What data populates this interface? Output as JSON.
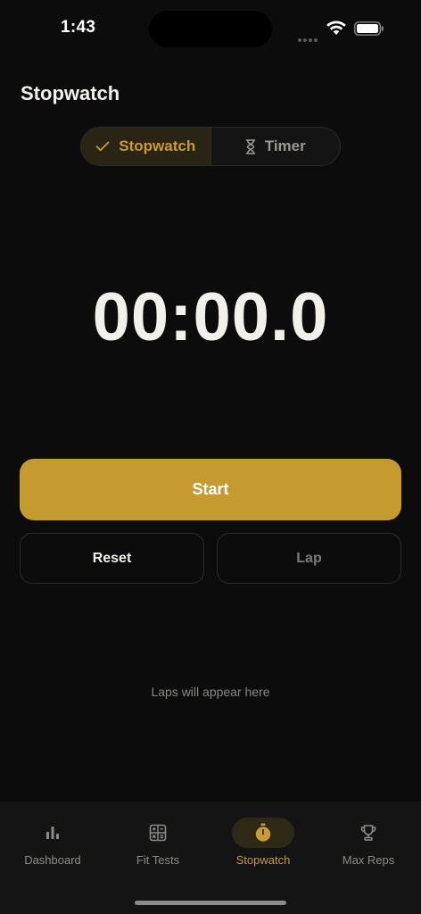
{
  "status_bar": {
    "time": "1:43"
  },
  "header": {
    "title": "Stopwatch"
  },
  "mode_switch": {
    "options": [
      {
        "label": "Stopwatch",
        "icon": "checkmark-icon",
        "selected": true
      },
      {
        "label": "Timer",
        "icon": "hourglass-icon",
        "selected": false
      }
    ]
  },
  "display": {
    "time": "00:00.0"
  },
  "controls": {
    "start_label": "Start",
    "reset_label": "Reset",
    "lap_label": "Lap"
  },
  "laps": {
    "empty_text": "Laps will appear here"
  },
  "tabbar": {
    "items": [
      {
        "label": "Dashboard",
        "icon": "bar-chart-icon",
        "active": false
      },
      {
        "label": "Fit Tests",
        "icon": "calculator-icon",
        "active": false
      },
      {
        "label": "Stopwatch",
        "icon": "stopwatch-icon",
        "active": true
      },
      {
        "label": "Max Reps",
        "icon": "trophy-icon",
        "active": false
      }
    ]
  },
  "colors": {
    "background": "#0c0c0c",
    "accent": "#c59a2f",
    "text_primary": "#f2f0ea",
    "text_muted": "#8e8c86"
  }
}
